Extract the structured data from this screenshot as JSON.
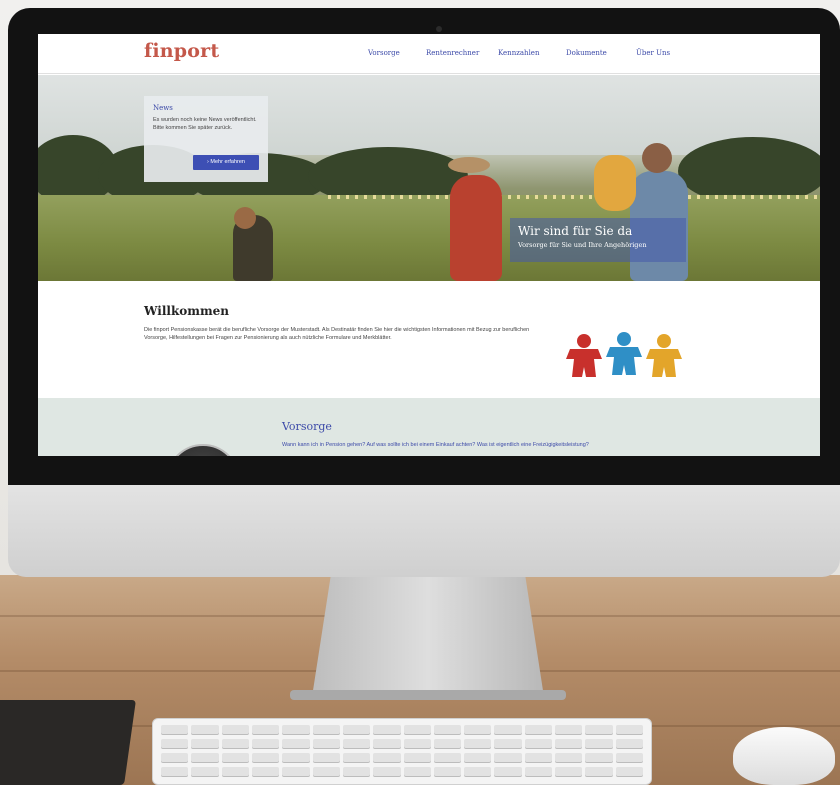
{
  "site": {
    "logo": "finport",
    "nav": [
      "Vorsorge",
      "Rentenrechner",
      "Kennzahlen",
      "Dokumente",
      "Über Uns"
    ]
  },
  "news": {
    "title": "News",
    "text": "Es wurden noch keine News veröffentlicht. Bitte kommen Sie später zurück.",
    "button": "› Mehr erfahren"
  },
  "hero": {
    "title": "Wir sind für Sie da",
    "subtitle": "Vorsorge für Sie und Ihre Angehörigen"
  },
  "welcome": {
    "title": "Willkommen",
    "text": "Die finport Pensionskasse berät die berufliche Vorsorge der Musterstadt. Als Destinatär finden Sie hier die wichtigsten Informationen mit Bezug zur beruflichen Vorsorge, Hilfestellungen bei Fragen zur Pensionierung als auch nützliche Formulare und Merkblätter."
  },
  "vorsorge": {
    "title": "Vorsorge",
    "text": "Wann kann ich in Pension gehen? Auf was sollte ich bei einem Einkauf achten? Was ist eigentlich eine Freizügigkeitsleistung?"
  },
  "colors": {
    "brand": "#c4584a",
    "accent": "#3c4aa8",
    "button": "#3d4fb4",
    "band": "#dfe7e3"
  }
}
